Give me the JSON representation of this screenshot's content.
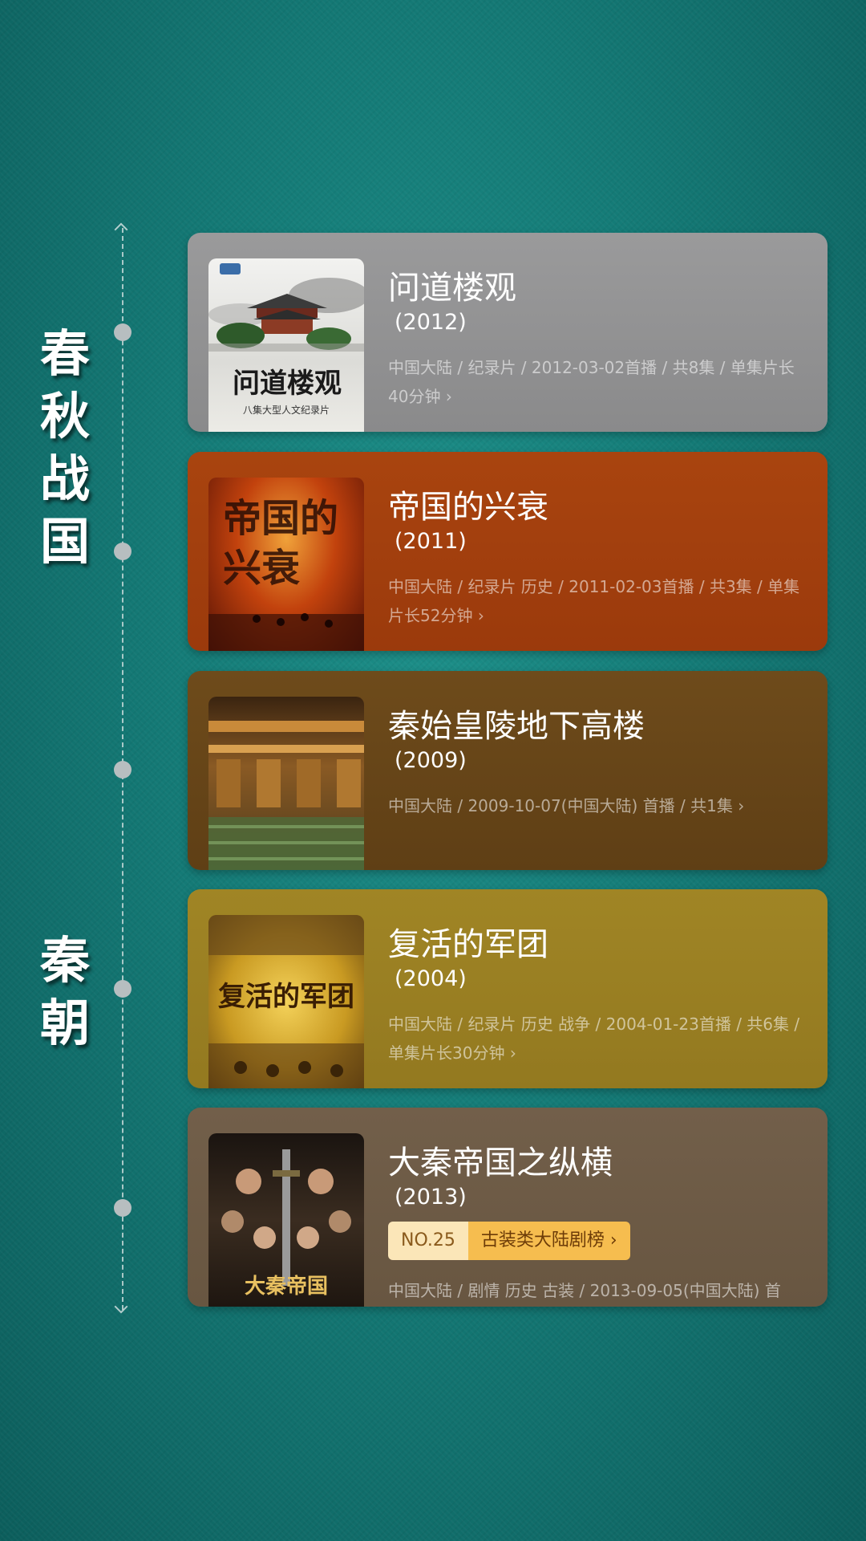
{
  "eras": [
    {
      "label": "春秋战国",
      "chars": [
        "春",
        "秋",
        "战",
        "国"
      ]
    },
    {
      "label": "秦朝",
      "chars": [
        "秦",
        "朝"
      ]
    }
  ],
  "cards": [
    {
      "title": "问道楼观",
      "year": "(2012)",
      "meta": "中国大陆 / 纪录片 / 2012-03-02首播 / 共8集 / 单集片长40分钟",
      "chevron": "›",
      "bg": "#8f8f90",
      "poster_text": "问道楼观",
      "poster_subtitle": "八集大型人文纪录片"
    },
    {
      "title": "帝国的兴衰",
      "year": "(2011)",
      "meta": "中国大陆 / 纪录片 历史 / 2011-02-03首播 / 共3集 / 单集片长52分钟",
      "chevron": "›",
      "bg": "#a8420f",
      "poster_text": "帝国的兴衰"
    },
    {
      "title": "秦始皇陵地下高楼",
      "year": "(2009)",
      "meta": "中国大陆 / 2009-10-07(中国大陆) 首播 / 共1集",
      "chevron": "›",
      "bg": "#6b4819"
    },
    {
      "title": "复活的军团",
      "year": "(2004)",
      "meta": "中国大陆 / 纪录片 历史 战争 / 2004-01-23首播 / 共6集 / 单集片长30分钟",
      "chevron": "›",
      "bg": "#9a7f24",
      "poster_text": "复活的军团"
    },
    {
      "title": "大秦帝国之纵横",
      "year": "(2013)",
      "rank_no": "NO.25",
      "rank_category": "古装类大陆剧榜",
      "chevron": "›",
      "meta": "中国大陆 / 剧情 历史 古装 / 2013-09-05(中国大陆) 首",
      "bg": "#6e5d49",
      "poster_text": "大秦帝国"
    }
  ]
}
